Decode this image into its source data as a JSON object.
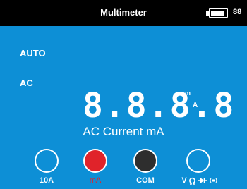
{
  "header": {
    "title": "Multimeter",
    "battery_percent_text": "88",
    "battery_level": 0.88,
    "battery_icon": "battery-icon"
  },
  "status": {
    "range_mode": "AUTO",
    "signal_type": "AC"
  },
  "display": {
    "reading": "8.8.8.8",
    "unit_prefix": "m",
    "unit_base": "A",
    "function_label": "AC Current mA"
  },
  "jacks": [
    {
      "label": "10A",
      "color": "#0d8fd6"
    },
    {
      "label": "mA",
      "color": "#e0232a"
    },
    {
      "label": "COM",
      "color": "#2e2e2e"
    },
    {
      "label": "V",
      "color": "#0d8fd6",
      "icons": [
        "ohm-icon",
        "diode-icon",
        "continuity-icon"
      ]
    }
  ],
  "colors": {
    "background": "#0d8fd6",
    "header": "#000000",
    "active_jack": "#e0232a"
  }
}
